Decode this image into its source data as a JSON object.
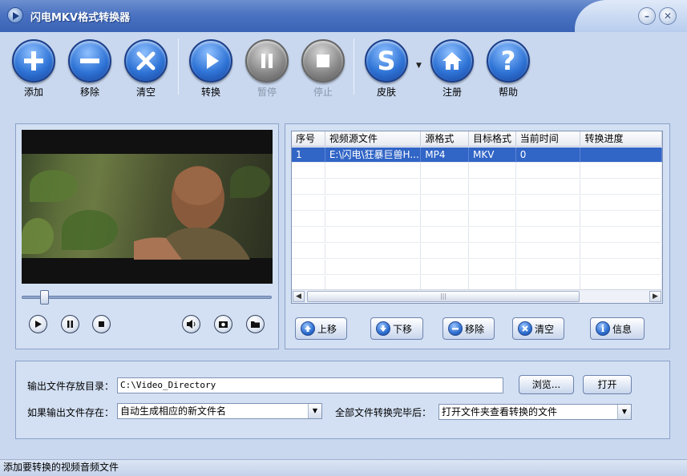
{
  "window": {
    "title": "闪电MKV格式转换器"
  },
  "toolbar": {
    "add": "添加",
    "remove": "移除",
    "clear": "清空",
    "convert": "转换",
    "pause": "暂停",
    "stop": "停止",
    "skin": "皮肤",
    "register": "注册",
    "help": "帮助"
  },
  "player": {
    "position": 0.09
  },
  "table": {
    "columns": [
      "序号",
      "视频源文件",
      "源格式",
      "目标格式",
      "当前时间",
      "转换进度"
    ],
    "rows": [
      {
        "index": "1",
        "source": "E:\\闪电\\狂暴巨兽H...",
        "src_format": "MP4",
        "target_format": "MKV",
        "current_time": "0",
        "progress": ""
      }
    ]
  },
  "list_buttons": {
    "up": "上移",
    "down": "下移",
    "remove": "移除",
    "clear": "清空",
    "info": "信息"
  },
  "settings": {
    "output_dir_label": "输出文件存放目录：",
    "output_dir_value": "C:\\Video_Directory",
    "browse": "浏览...",
    "open": "打开",
    "exists_label": "如果输出文件存在：",
    "exists_value": "自动生成相应的新文件名",
    "after_label": "全部文件转换完毕后：",
    "after_value": "打开文件夹查看转换的文件"
  },
  "status": {
    "text": "添加要转换的视频音频文件"
  },
  "colors": {
    "accent": "#3165c6",
    "window_bg": "#c9d8ef",
    "panel_bg": "#d3e0f3"
  }
}
